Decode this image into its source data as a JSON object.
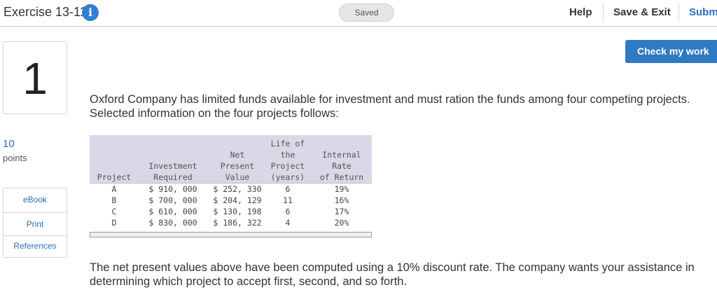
{
  "header": {
    "title": "Exercise 13-11",
    "info_glyph": "i",
    "status": "Saved",
    "help": "Help",
    "save_exit": "Save & Exit",
    "submit": "Subm"
  },
  "question": {
    "number": "1",
    "points_value": "10",
    "points_label": "points",
    "check_button": "Check my work",
    "intro_text": "Oxford Company has limited funds available for investment and must ration the funds among four competing projects. Selected information on the four projects follows:",
    "followup_text": "The net present values above have been computed using a 10% discount rate. The company wants your assistance in determining which project to accept first, second, and so forth."
  },
  "sidebar": {
    "ebook": "eBook",
    "print": "Print",
    "references": "References"
  },
  "table": {
    "headers": {
      "project": [
        "Project"
      ],
      "investment": [
        "Investment",
        "Required"
      ],
      "npv": [
        "Net",
        "Present",
        "Value"
      ],
      "life": [
        "Life of",
        "the",
        "Project",
        "(years)"
      ],
      "irr": [
        "Internal",
        "Rate",
        "of Return"
      ]
    },
    "rows": [
      {
        "project": "A",
        "investment": "$ 910, 000",
        "npv": "$ 252, 330",
        "life": "6",
        "irr": "19%"
      },
      {
        "project": "B",
        "investment": "$ 700, 000",
        "npv": "$ 204, 129",
        "life": "11",
        "irr": "16%"
      },
      {
        "project": "C",
        "investment": "$ 610, 000",
        "npv": "$ 130, 198",
        "life": "6",
        "irr": "17%"
      },
      {
        "project": "D",
        "investment": "$ 830, 000",
        "npv": "$ 186, 322",
        "life": "4",
        "irr": "20%"
      }
    ]
  },
  "colors": {
    "accent": "#2f7ac2",
    "link": "#2a6ebb",
    "table_header_bg": "#d8d8e6"
  }
}
